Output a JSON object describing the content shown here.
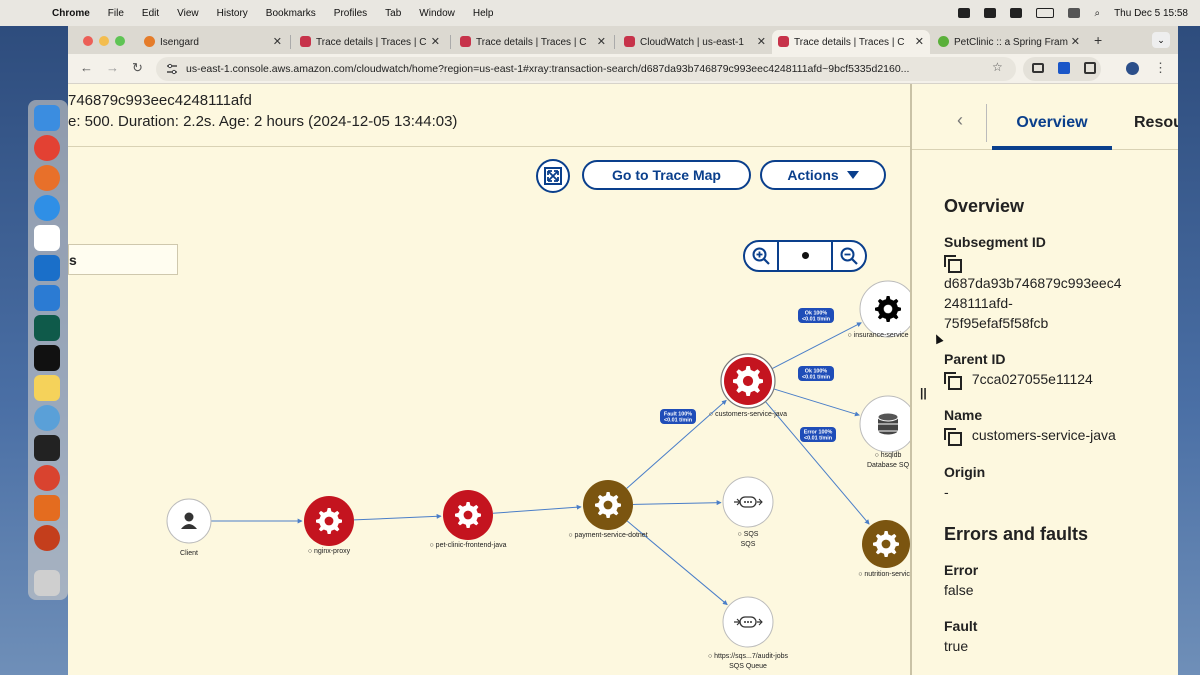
{
  "menubar": {
    "app": "Chrome",
    "items": [
      "File",
      "Edit",
      "View",
      "History",
      "Bookmarks",
      "Profiles",
      "Tab",
      "Window",
      "Help"
    ],
    "clock": "Thu Dec 5  15:58"
  },
  "tabs": [
    {
      "title": "Isengard"
    },
    {
      "title": "Trace details | Traces | C"
    },
    {
      "title": "Trace details | Traces | C"
    },
    {
      "title": "CloudWatch | us-east-1"
    },
    {
      "title": "Trace details | Traces | C"
    },
    {
      "title": "PetClinic :: a Spring Fram"
    }
  ],
  "url": "us-east-1.console.aws.amazon.com/cloudwatch/home?region=us-east-1#xray:transaction-search/d687da93b746879c993eec4248111afd~9bcf5335d2160...",
  "header": {
    "line1": "746879c993eec4248111afd",
    "line2": "e: 500. Duration: 2.2s. Age: 2 hours (2024-12-05 13:44:03)"
  },
  "map": {
    "go_to_trace_map": "Go to Trace Map",
    "actions": "Actions",
    "filter_partial": "s",
    "colors": {
      "fault": "#c4141f",
      "ok_brown": "#7b5510",
      "neutral": "#ffffff",
      "edge": "#4a7ec8",
      "edge_label": "#1f4db8"
    },
    "nodes": [
      {
        "id": "client",
        "label": "Client",
        "sublabel": "",
        "kind": "client"
      },
      {
        "id": "nginx",
        "label": "nginx-proxy",
        "sublabel": "",
        "kind": "fault"
      },
      {
        "id": "frontend",
        "label": "pet-clinic-frontend-java",
        "sublabel": "",
        "kind": "fault"
      },
      {
        "id": "payment",
        "label": "payment-service-dotnet",
        "sublabel": "",
        "kind": "ok"
      },
      {
        "id": "customers",
        "label": "customers-service-java",
        "sublabel": "",
        "kind": "fault-selected"
      },
      {
        "id": "insurance",
        "label": "insurance-service",
        "sublabel": "",
        "kind": "neutral"
      },
      {
        "id": "hsqldb",
        "label": "hsqldb",
        "sublabel": "Database SQ",
        "kind": "db"
      },
      {
        "id": "nutrition",
        "label": "nutrition-service",
        "sublabel": "",
        "kind": "ok"
      },
      {
        "id": "sqs",
        "label": "SQS",
        "sublabel": "SQS",
        "kind": "queue"
      },
      {
        "id": "audit",
        "label": "https://sqs...7/audit-jobs",
        "sublabel": "SQS Queue",
        "kind": "queue"
      }
    ],
    "edge_labels": [
      {
        "line1": "Fault 100%",
        "line2": "<0.01 t/min"
      },
      {
        "line1": "Ok 100%",
        "line2": "<0.01 t/min"
      },
      {
        "line1": "Ok 100%",
        "line2": "<0.01 t/min"
      },
      {
        "line1": "Error 100%",
        "line2": "<0.01 t/min"
      }
    ]
  },
  "panel": {
    "tab_overview": "Overview",
    "tab_resources": "Resou",
    "heading": "Overview",
    "subsegment_label": "Subsegment ID",
    "subsegment_line1": "d687da93b746879c993eec4",
    "subsegment_line2": "248111afd-",
    "subsegment_line3": "75f95efaf5f58fcb",
    "parent_label": "Parent ID",
    "parent_value": "7cca027055e11124",
    "name_label": "Name",
    "name_value": "customers-service-java",
    "origin_label": "Origin",
    "origin_value": "-",
    "errors_heading": "Errors and faults",
    "error_label": "Error",
    "error_value": "false",
    "fault_label": "Fault",
    "fault_value": "true"
  }
}
